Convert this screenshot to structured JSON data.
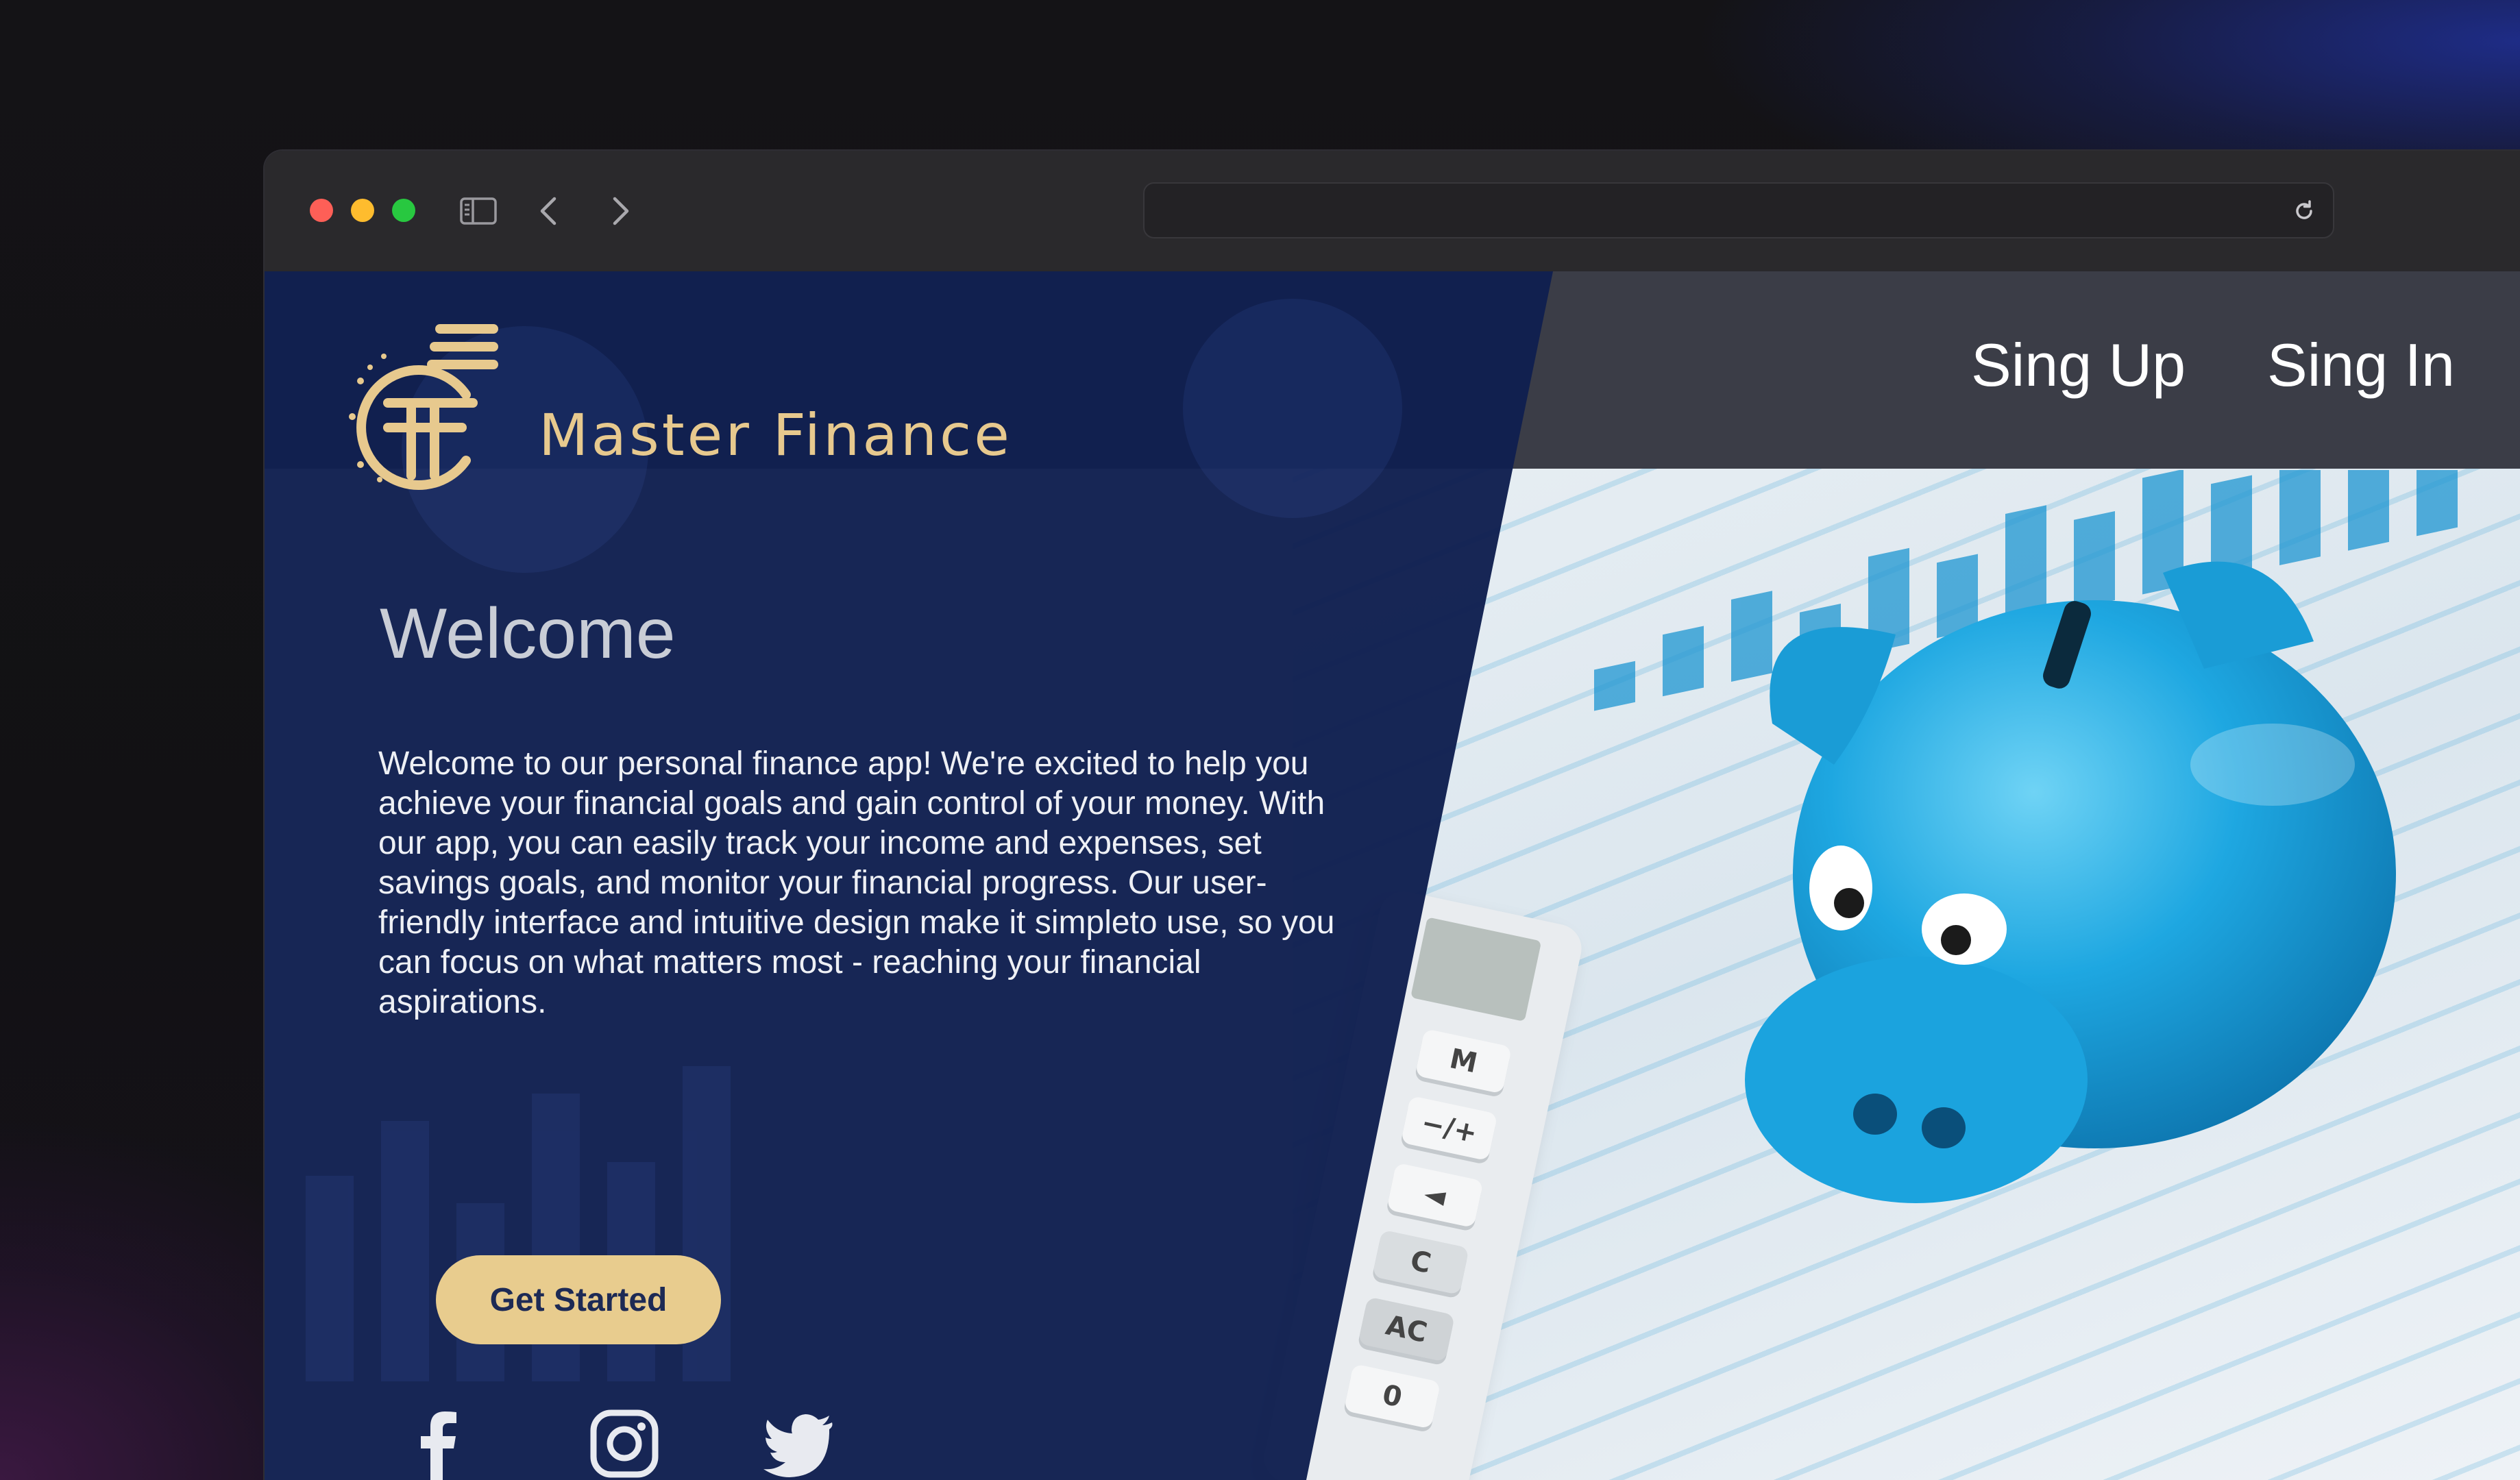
{
  "browser": {
    "url_value": "",
    "controls": {
      "sidebar_icon": "sidebar-icon",
      "back_icon": "chevron-left-icon",
      "forward_icon": "chevron-right-icon",
      "reload_icon": "reload-icon"
    }
  },
  "site": {
    "brand_name": "Master Finance",
    "nav": {
      "signup_label": "Sing Up",
      "signin_label": "Sing In"
    },
    "hero": {
      "title": "Welcome",
      "body": "Welcome to our personal finance app! We're excited to help you achieve your financial goals and gain control of your money. With our app, you can easily track your income and expenses, set savings goals, and monitor your financial progress. Our user-friendly interface and intuitive design make it simpleto use, so you can focus on what matters most - reaching your financial aspirations.",
      "cta_label": "Get Started"
    },
    "social": [
      "facebook-icon",
      "instagram-icon",
      "twitter-icon"
    ],
    "colors": {
      "navy_overlay": "#0f1f4f",
      "gold_accent": "#e8cc8e",
      "header_dark": "#3b3d47",
      "piggy_blue": "#1ea7e1"
    }
  }
}
